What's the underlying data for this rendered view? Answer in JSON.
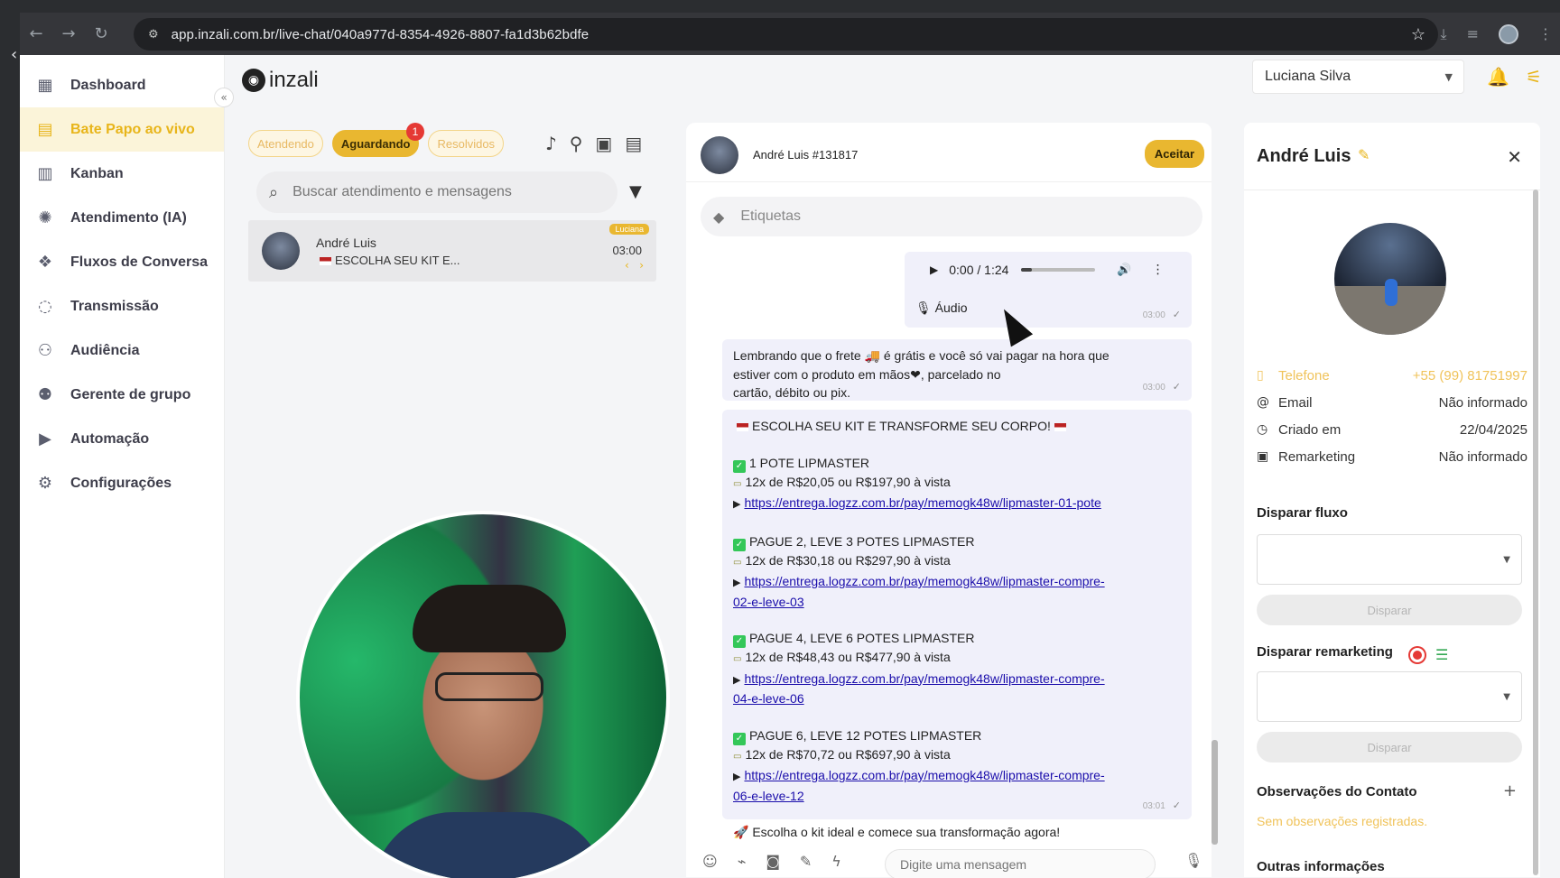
{
  "browser": {
    "url": "app.inzali.com.br/live-chat/040a977d-8354-4926-8807-fa1d3b62bdfe"
  },
  "app": {
    "logo_text": "inzali",
    "current_user": "Luciana Silva"
  },
  "sidebar": {
    "items": [
      {
        "label": "Dashboard",
        "icon": "dashboard-icon"
      },
      {
        "label": "Bate Papo ao vivo",
        "icon": "chat-icon"
      },
      {
        "label": "Kanban",
        "icon": "kanban-icon"
      },
      {
        "label": "Atendimento (IA)",
        "icon": "ai-icon"
      },
      {
        "label": "Fluxos de Conversa",
        "icon": "flow-icon"
      },
      {
        "label": "Transmissão",
        "icon": "broadcast-icon"
      },
      {
        "label": "Audiência",
        "icon": "audience-icon"
      },
      {
        "label": "Gerente de grupo",
        "icon": "group-manager-icon"
      },
      {
        "label": "Automação",
        "icon": "play-icon"
      },
      {
        "label": "Configurações",
        "icon": "gear-icon"
      }
    ],
    "active_index": 1
  },
  "conversations": {
    "tabs": [
      {
        "label": "Atendendo"
      },
      {
        "label": "Aguardando",
        "badge": "1"
      },
      {
        "label": "Resolvidos"
      }
    ],
    "active_tab": 1,
    "search_placeholder": "Buscar atendimento e mensagens",
    "items": [
      {
        "name": "André Luis",
        "preview": "ESCOLHA SEU KIT E...",
        "agent_tag": "Luciana",
        "time": "03:00"
      }
    ]
  },
  "chat": {
    "contact_title": "André Luis #131817",
    "accept_label": "Aceitar",
    "tags_placeholder": "Etiquetas",
    "audio": {
      "time": "0:00 / 1:24",
      "label": "Áudio",
      "sent_at": "03:00",
      "progress": 0.14
    },
    "messages": [
      {
        "id": "m1",
        "lines": [
          "Lembrando que o frete 🚚 é grátis e você só vai pagar na hora que",
          "estiver com o produto em mãos❤, parcelado no",
          "cartão, débito ou pix."
        ],
        "time": "03:00"
      }
    ],
    "kit_message": {
      "headline": "ESCOLHA SEU KIT E TRANSFORME SEU CORPO!",
      "offers": [
        {
          "title": "1 POTE LIPMASTER",
          "price": "12x de R$20,05 ou R$197,90 à vista",
          "link1": "https://entrega.logzz.com.br/pay/memogk48w/lipmaster-01-pote",
          "link2": ""
        },
        {
          "title": "PAGUE 2, LEVE 3 POTES LIPMASTER",
          "price": "12x de R$30,18 ou R$297,90 à vista",
          "link1": "https://entrega.logzz.com.br/pay/memogk48w/lipmaster-compre-",
          "link2": "02-e-leve-03"
        },
        {
          "title": "PAGUE 4, LEVE 6 POTES LIPMASTER",
          "price": "12x de R$48,43 ou R$477,90 à vista",
          "link1": "https://entrega.logzz.com.br/pay/memogk48w/lipmaster-compre-",
          "link2": "04-e-leve-06"
        },
        {
          "title": "PAGUE 6, LEVE 12 POTES LIPMASTER",
          "price": "12x de R$70,72 ou R$697,90 à vista",
          "link1": "https://entrega.logzz.com.br/pay/memogk48w/lipmaster-compre-",
          "link2": "06-e-leve-12"
        }
      ],
      "footer": "🚀 Escolha o kit ideal e comece sua transformação agora!",
      "time": "03:01"
    },
    "composer_placeholder": "Digite uma mensagem"
  },
  "contact": {
    "name": "André Luis",
    "fields": [
      {
        "label": "Telefone",
        "value": "+55 (99) 81751997",
        "icon": "phone-icon"
      },
      {
        "label": "Email",
        "value": "Não informado",
        "icon": "at-icon"
      },
      {
        "label": "Criado em",
        "value": "22/04/2025",
        "icon": "clock-icon"
      },
      {
        "label": "Remarketing",
        "value": "Não informado",
        "icon": "remarketing-icon"
      }
    ],
    "flow_title": "Disparar fluxo",
    "flow_button": "Disparar",
    "remarketing_title": "Disparar remarketing",
    "remarketing_button": "Disparar",
    "notes_title": "Observações do Contato",
    "notes_empty": "Sem observações registradas.",
    "other_title": "Outras informações"
  },
  "colors": {
    "accent": "#e9b730",
    "active_bg": "#fbf4d9",
    "badge": "#e53935",
    "bubble": "#f0f0fa"
  }
}
